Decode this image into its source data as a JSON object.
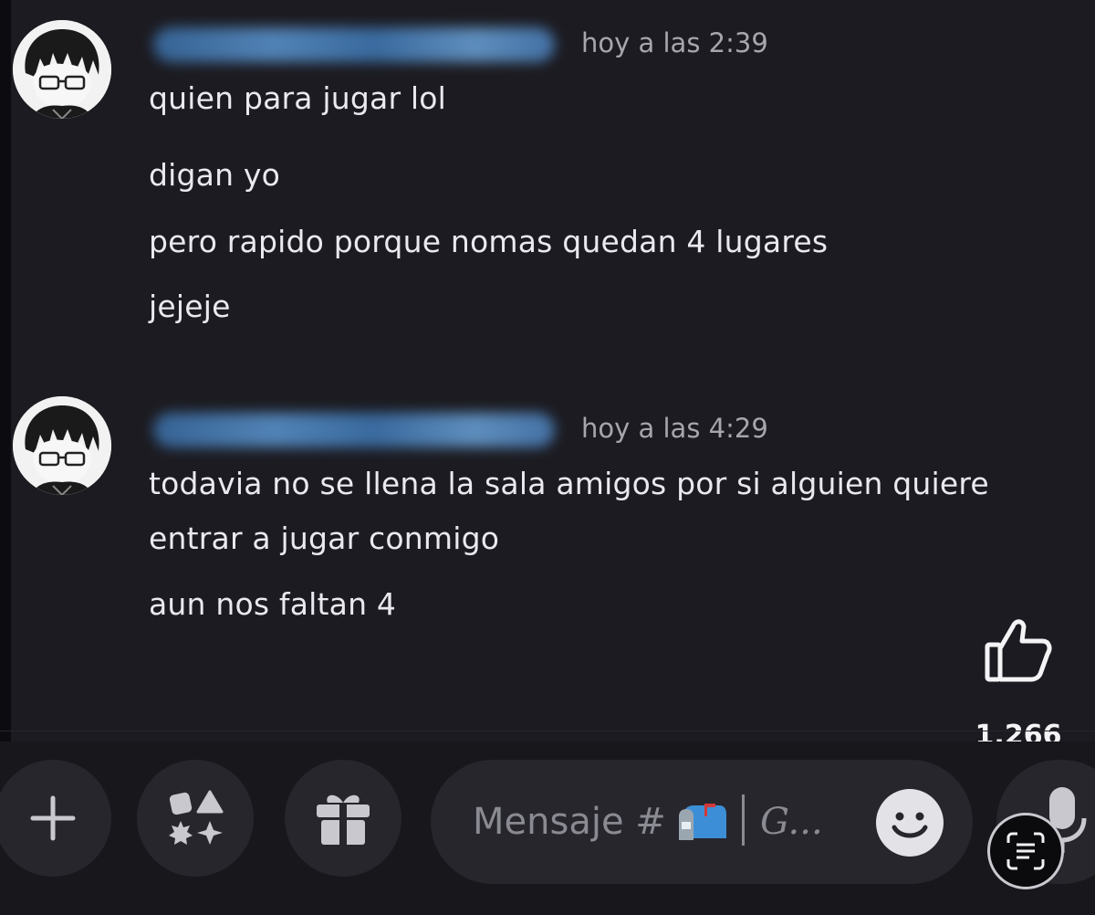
{
  "messages": [
    {
      "author": "",
      "timestamp": "hoy a las 2:39",
      "lines": [
        "quien para jugar lol",
        "digan yo",
        "pero rapido porque nomas quedan 4 lugares",
        "jejeje"
      ]
    },
    {
      "author": "",
      "timestamp": "hoy a las 4:29",
      "lines": [
        "todavia no se llena la sala amigos por si alguien quiere",
        "entrar a jugar conmigo",
        "aun nos faltan 4"
      ]
    }
  ],
  "reaction": {
    "icon": "thumbs-up-icon",
    "count": "1,266"
  },
  "composer": {
    "placeholder": "Mensaje #",
    "channel_icon": "mailbox-icon",
    "gif_hint": "G..."
  },
  "icons": [
    "plus-icon",
    "apps-icon",
    "gift-icon",
    "smile-icon",
    "mic-icon",
    "scan-icon"
  ],
  "colors": {
    "background": "#1c1b21",
    "bar": "#18171c",
    "button": "#27262d",
    "username_blur": "#4a80bc",
    "text": "#e9e9ee",
    "muted": "#a6a6ad"
  }
}
